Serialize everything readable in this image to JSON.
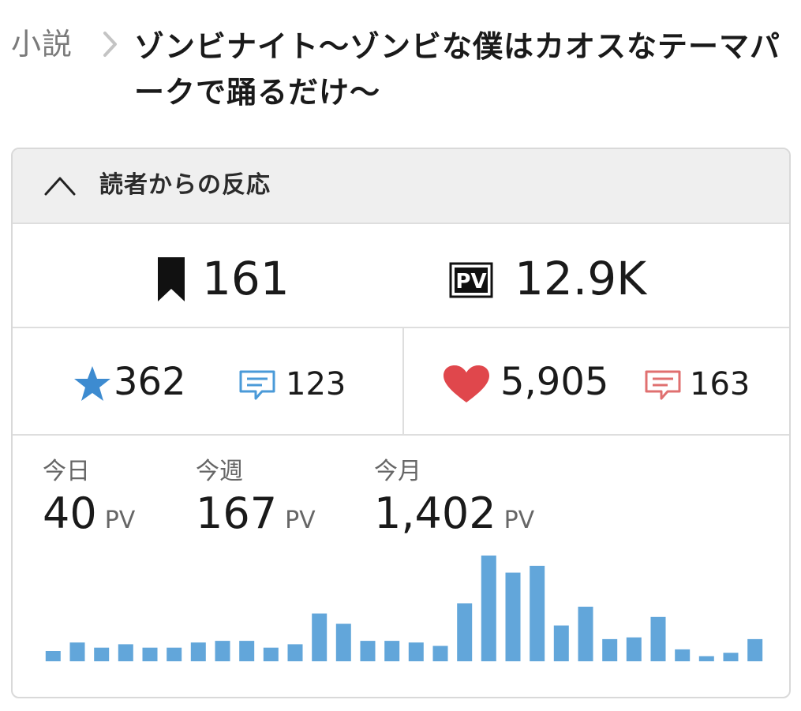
{
  "breadcrumb": {
    "parent": "小説",
    "title": "ゾンビナイト〜ゾンビな僕はカオスなテーマパークで踊るだけ〜"
  },
  "panel": {
    "title": "読者からの反応"
  },
  "reactions": {
    "bookmarks": "161",
    "pv": "12.9K",
    "pv_icon_label": "PV",
    "stars": "362",
    "star_reviews": "123",
    "hearts": "5,905",
    "heart_comments": "163"
  },
  "stats": {
    "today": {
      "label": "今日",
      "value": "40",
      "unit": "PV"
    },
    "week": {
      "label": "今週",
      "value": "167",
      "unit": "PV"
    },
    "month": {
      "label": "今月",
      "value": "1,402",
      "unit": "PV"
    }
  },
  "colors": {
    "bar": "#62a6da",
    "star": "#3d8bd0",
    "heart": "#e0474c",
    "review_blue": "#4a9ad8",
    "review_red": "#e07070"
  },
  "chart_data": {
    "type": "bar",
    "title": "",
    "values": [
      6,
      11,
      8,
      10,
      8,
      8,
      11,
      12,
      12,
      8,
      10,
      28,
      22,
      12,
      12,
      11,
      9,
      34,
      62,
      52,
      56,
      21,
      32,
      13,
      14,
      26,
      7,
      3,
      5,
      13
    ]
  }
}
